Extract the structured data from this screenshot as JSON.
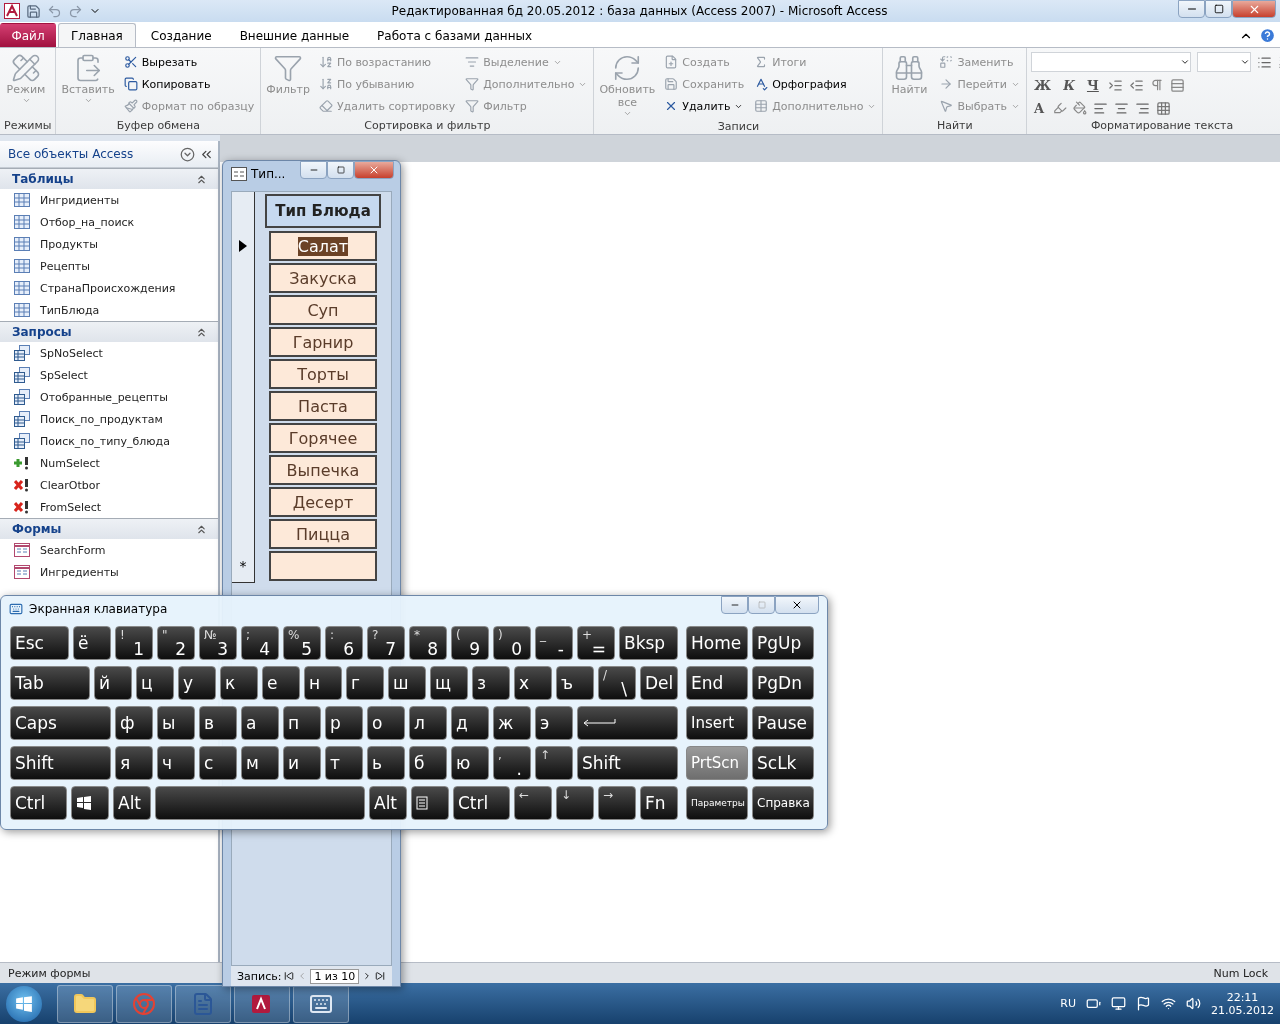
{
  "window": {
    "title": "Редактированная бд 20.05.2012 : база данных (Access 2007)  -  Microsoft Access"
  },
  "tabs": [
    {
      "label": "Файл",
      "kind": "file",
      "selected": false
    },
    {
      "label": "Главная",
      "kind": "tab",
      "selected": true
    },
    {
      "label": "Создание",
      "kind": "tab",
      "selected": false
    },
    {
      "label": "Внешние данные",
      "kind": "tab",
      "selected": false
    },
    {
      "label": "Работа с базами данных",
      "kind": "tab",
      "selected": false
    }
  ],
  "ribbon": {
    "groups": [
      {
        "label": "Режимы",
        "large": {
          "label": "Режим",
          "disabled": true,
          "dropdown": true
        }
      },
      {
        "label": "Буфер обмена",
        "large": {
          "label": "Вставить",
          "disabled": true,
          "dropdown": true
        },
        "small": [
          {
            "label": "Вырезать",
            "disabled": false,
            "dropdown": false
          },
          {
            "label": "Копировать",
            "disabled": false,
            "dropdown": false
          },
          {
            "label": "Формат по образцу",
            "disabled": true,
            "dropdown": false
          }
        ]
      },
      {
        "label": "Сортировка и фильтр",
        "large": {
          "label": "Фильтр",
          "disabled": true,
          "dropdown": false
        },
        "small": [
          {
            "label": "По возрастанию",
            "disabled": true,
            "dropdown": false
          },
          {
            "label": "По убыванию",
            "disabled": true,
            "dropdown": false
          },
          {
            "label": "Удалить сортировку",
            "disabled": true,
            "dropdown": false
          },
          {
            "label": "Выделение",
            "disabled": true,
            "dropdown": true
          },
          {
            "label": "Дополнительно",
            "disabled": true,
            "dropdown": true
          },
          {
            "label": "Фильтр",
            "disabled": true,
            "dropdown": false
          }
        ]
      },
      {
        "label": "Записи",
        "large": {
          "label": "Обновить все",
          "disabled": true,
          "dropdown": true
        },
        "small": [
          {
            "label": "Создать",
            "disabled": true,
            "dropdown": false
          },
          {
            "label": "Сохранить",
            "disabled": true,
            "dropdown": false
          },
          {
            "label": "Удалить",
            "disabled": false,
            "dropdown": true
          },
          {
            "label": "Итоги",
            "disabled": true,
            "dropdown": false
          },
          {
            "label": "Орфография",
            "disabled": false,
            "dropdown": false
          },
          {
            "label": "Дополнительно",
            "disabled": true,
            "dropdown": true
          }
        ]
      },
      {
        "label": "Найти",
        "large": {
          "label": "Найти",
          "disabled": true,
          "dropdown": false
        },
        "small": [
          {
            "label": "Заменить",
            "disabled": true,
            "dropdown": false
          },
          {
            "label": "Перейти",
            "disabled": true,
            "dropdown": true
          },
          {
            "label": "Выбрать",
            "disabled": true,
            "dropdown": true
          }
        ]
      }
    ],
    "format": {
      "label": "Форматирование текста",
      "font_buttons": [
        "Ж",
        "К",
        "Ч"
      ],
      "color_button": "A"
    }
  },
  "nav": {
    "header": "Все объекты Access",
    "sections": [
      {
        "title": "Таблицы",
        "expanded": true,
        "items": [
          {
            "label": "Ингридиенты",
            "kind": "table"
          },
          {
            "label": "Отбор_на_поиск",
            "kind": "table"
          },
          {
            "label": "Продукты",
            "kind": "table"
          },
          {
            "label": "Рецепты",
            "kind": "table"
          },
          {
            "label": "СтранаПроисхождения",
            "kind": "table"
          },
          {
            "label": "ТипБлюда",
            "kind": "table"
          }
        ]
      },
      {
        "title": "Запросы",
        "expanded": true,
        "items": [
          {
            "label": "SpNoSelect",
            "kind": "query"
          },
          {
            "label": "SpSelect",
            "kind": "query"
          },
          {
            "label": "Отобранные_рецепты",
            "kind": "query"
          },
          {
            "label": "Поиск_по_продуктам",
            "kind": "query"
          },
          {
            "label": "Поиск_по_типу_блюда",
            "kind": "query"
          },
          {
            "label": "NumSelect",
            "kind": "append"
          },
          {
            "label": "ClearOtbor",
            "kind": "delete"
          },
          {
            "label": "FromSelect",
            "kind": "delete"
          }
        ]
      },
      {
        "title": "Формы",
        "expanded": true,
        "items": [
          {
            "label": "SearchForm",
            "kind": "form"
          },
          {
            "label": "Ингредиенты",
            "kind": "form"
          }
        ]
      }
    ]
  },
  "form": {
    "title": "Тип...",
    "column_header": "Тип Блюда",
    "rows": [
      {
        "value": "Салат",
        "selected": true
      },
      {
        "value": "Закуска",
        "selected": false
      },
      {
        "value": "Суп",
        "selected": false
      },
      {
        "value": "Гарнир",
        "selected": false
      },
      {
        "value": "Торты",
        "selected": false
      },
      {
        "value": "Паста",
        "selected": false
      },
      {
        "value": "Горячее",
        "selected": false
      },
      {
        "value": "Выпечка",
        "selected": false
      },
      {
        "value": "Десерт",
        "selected": false
      },
      {
        "value": "Пицца",
        "selected": false
      }
    ],
    "new_row_marker": "*",
    "navigator": {
      "label": "Запись:",
      "position": "1 из 10"
    }
  },
  "keyboard": {
    "title": "Экранная клавиатура",
    "main_rows": [
      [
        {
          "label": "Esc",
          "kind": "wide"
        },
        {
          "label": "ё",
          "kind": "key"
        },
        {
          "label": "1",
          "shift": "!",
          "kind": "key"
        },
        {
          "label": "2",
          "shift": "\"",
          "kind": "key"
        },
        {
          "label": "3",
          "shift": "№",
          "kind": "key"
        },
        {
          "label": "4",
          "shift": ";",
          "kind": "key"
        },
        {
          "label": "5",
          "shift": "%",
          "kind": "key"
        },
        {
          "label": "6",
          "shift": ":",
          "kind": "key"
        },
        {
          "label": "7",
          "shift": "?",
          "kind": "key"
        },
        {
          "label": "8",
          "shift": "*",
          "kind": "key"
        },
        {
          "label": "9",
          "shift": "(",
          "kind": "key"
        },
        {
          "label": "0",
          "shift": ")",
          "kind": "key"
        },
        {
          "label": "-",
          "shift": "_",
          "kind": "key"
        },
        {
          "label": "=",
          "shift": "+",
          "kind": "key"
        },
        {
          "label": "Bksp",
          "kind": "wide"
        }
      ],
      [
        {
          "label": "Tab",
          "kind": "wide"
        },
        {
          "label": "й",
          "kind": "key"
        },
        {
          "label": "ц",
          "kind": "key"
        },
        {
          "label": "у",
          "kind": "key"
        },
        {
          "label": "к",
          "kind": "key"
        },
        {
          "label": "е",
          "kind": "key"
        },
        {
          "label": "н",
          "kind": "key"
        },
        {
          "label": "г",
          "kind": "key"
        },
        {
          "label": "ш",
          "kind": "key"
        },
        {
          "label": "щ",
          "kind": "key"
        },
        {
          "label": "з",
          "kind": "key"
        },
        {
          "label": "х",
          "kind": "key"
        },
        {
          "label": "ъ",
          "kind": "key"
        },
        {
          "label": "\\",
          "shift": "/",
          "kind": "key"
        },
        {
          "label": "Del",
          "kind": "key"
        }
      ],
      [
        {
          "label": "Caps",
          "kind": "wide"
        },
        {
          "label": "ф",
          "kind": "key"
        },
        {
          "label": "ы",
          "kind": "key"
        },
        {
          "label": "в",
          "kind": "key"
        },
        {
          "label": "а",
          "kind": "key"
        },
        {
          "label": "п",
          "kind": "key"
        },
        {
          "label": "р",
          "kind": "key"
        },
        {
          "label": "о",
          "kind": "key"
        },
        {
          "label": "л",
          "kind": "key"
        },
        {
          "label": "д",
          "kind": "key"
        },
        {
          "label": "ж",
          "kind": "key"
        },
        {
          "label": "э",
          "kind": "key"
        },
        {
          "kind": "enter"
        }
      ],
      [
        {
          "label": "Shift",
          "kind": "wide"
        },
        {
          "label": "я",
          "kind": "key"
        },
        {
          "label": "ч",
          "kind": "key"
        },
        {
          "label": "с",
          "kind": "key"
        },
        {
          "label": "м",
          "kind": "key"
        },
        {
          "label": "и",
          "kind": "key"
        },
        {
          "label": "т",
          "kind": "key"
        },
        {
          "label": "ь",
          "kind": "key"
        },
        {
          "label": "б",
          "kind": "key"
        },
        {
          "label": "ю",
          "kind": "key"
        },
        {
          "label": ".",
          "shift": ",",
          "kind": "key"
        },
        {
          "shift": "↑",
          "kind": "key"
        },
        {
          "label": "Shift",
          "kind": "wide"
        }
      ],
      [
        {
          "label": "Ctrl",
          "kind": "wide"
        },
        {
          "kind": "win"
        },
        {
          "label": "Alt",
          "kind": "key"
        },
        {
          "kind": "space"
        },
        {
          "label": "Alt",
          "kind": "key"
        },
        {
          "kind": "menu"
        },
        {
          "label": "Ctrl",
          "kind": "wide"
        },
        {
          "shift": "←",
          "kind": "key"
        },
        {
          "shift": "↓",
          "kind": "key"
        },
        {
          "shift": "→",
          "kind": "key"
        },
        {
          "label": "Fn",
          "kind": "key"
        }
      ]
    ],
    "side_rows": [
      [
        {
          "label": "Home",
          "kind": "nav",
          "highlighted": false
        },
        {
          "label": "PgUp",
          "kind": "nav",
          "highlighted": false
        }
      ],
      [
        {
          "label": "End",
          "kind": "nav",
          "highlighted": false
        },
        {
          "label": "PgDn",
          "kind": "nav",
          "highlighted": false
        }
      ],
      [
        {
          "label": "Insert",
          "kind": "nav",
          "highlighted": false
        },
        {
          "label": "Pause",
          "kind": "nav",
          "highlighted": false
        }
      ],
      [
        {
          "label": "PrtScn",
          "kind": "nav",
          "highlighted": true
        },
        {
          "label": "ScLk",
          "kind": "nav",
          "highlighted": false
        }
      ],
      [
        {
          "label": "Параметры",
          "kind": "small",
          "highlighted": false
        },
        {
          "label": "Справка",
          "kind": "nav",
          "highlighted": false
        }
      ]
    ]
  },
  "status_bar": {
    "left": "Режим формы",
    "right": "Num Lock"
  },
  "taskbar": {
    "language": "RU",
    "time": "22:11",
    "date": "21.05.2012"
  }
}
